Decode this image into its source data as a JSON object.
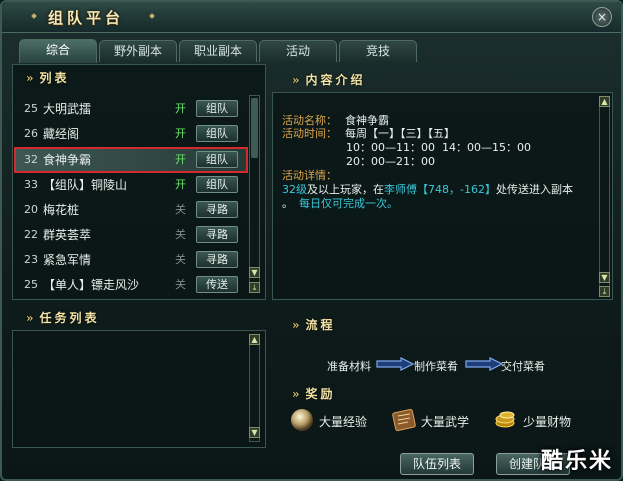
{
  "window": {
    "title": "组队平台",
    "close_label": "×"
  },
  "tabs": [
    {
      "label": "综合",
      "active": true
    },
    {
      "label": "野外副本",
      "active": false
    },
    {
      "label": "职业副本",
      "active": false
    },
    {
      "label": "活动",
      "active": false
    },
    {
      "label": "竞技",
      "active": false
    }
  ],
  "list_section": {
    "title": "列表"
  },
  "activities": [
    {
      "level": "25",
      "name": "大明武擂",
      "state": "开",
      "open": true,
      "action": "组队",
      "selected": false
    },
    {
      "level": "26",
      "name": "藏经阁",
      "state": "开",
      "open": true,
      "action": "组队",
      "selected": false
    },
    {
      "level": "32",
      "name": "食神争霸",
      "state": "开",
      "open": true,
      "action": "组队",
      "selected": true
    },
    {
      "level": "33",
      "name": "【组队】铜陵山",
      "state": "开",
      "open": true,
      "action": "组队",
      "selected": false
    },
    {
      "level": "20",
      "name": "梅花桩",
      "state": "关",
      "open": false,
      "action": "寻路",
      "selected": false
    },
    {
      "level": "22",
      "name": "群英荟萃",
      "state": "关",
      "open": false,
      "action": "寻路",
      "selected": false
    },
    {
      "level": "23",
      "name": "紧急军情",
      "state": "关",
      "open": false,
      "action": "寻路",
      "selected": false
    },
    {
      "level": "25",
      "name": "【单人】镖走风沙",
      "state": "关",
      "open": false,
      "action": "传送",
      "selected": false
    }
  ],
  "task_section": {
    "title": "任务列表"
  },
  "content_section": {
    "title": "内容介绍"
  },
  "details": {
    "name_label": "活动名称：",
    "name_value": "食神争霸",
    "time_label": "活动时间：",
    "time_days": "每周【一】【三】【五】",
    "time_slot1": "10：00—11：00",
    "time_slot2": "14：00—15：00",
    "time_slot3": "20：00—21：00",
    "detail_label": "活动详情：",
    "detail_level": "32级",
    "detail_text1": "及以上玩家，在",
    "detail_npc": "李师傅",
    "detail_coords": "【748，-162】",
    "detail_text2": "处传送进入副本",
    "detail_text3": "。",
    "detail_daily": "每日仅可完成一次。"
  },
  "flow_section": {
    "title": "流程"
  },
  "flow": {
    "step1": "准备材料",
    "step2": "制作菜肴",
    "step3": "交付菜肴"
  },
  "reward_section": {
    "title": "奖励"
  },
  "rewards": [
    {
      "label": "大量经验",
      "icon": "experience-orb-icon"
    },
    {
      "label": "大量武学",
      "icon": "martial-scroll-icon"
    },
    {
      "label": "少量财物",
      "icon": "coins-icon"
    }
  ],
  "buttons": {
    "team_list": "队伍列表",
    "create_team": "创建队伍"
  },
  "watermark": "酷乐米",
  "colors": {
    "title_gold": "#f4e9b8",
    "label_orange": "#d9a54a",
    "open_green": "#6be36b",
    "highlight_cyan": "#39c7d8",
    "selection_red": "#d32b2b"
  }
}
